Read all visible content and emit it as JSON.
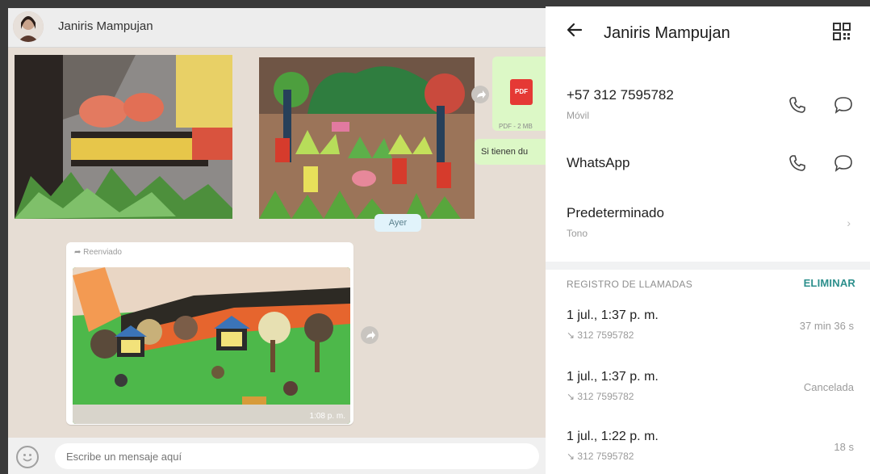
{
  "chat": {
    "contact_name": "Janiris Mampujan",
    "pdf_label": "PDF",
    "pdf_meta": "PDF - 2 MB",
    "text_preview": "Si tienen du",
    "chip": "Ayer",
    "forwarded_label": "Reenviado",
    "photo_time": "1:08 p. m.",
    "composer_placeholder": "Escribe un mensaje aquí",
    "icons": {
      "avatar": "avatar",
      "share": "share-icon",
      "emoji": "emoji-icon"
    }
  },
  "contact": {
    "title": "Janiris Mampujan",
    "phone_row": {
      "number": "+57 312 7595782",
      "label": "Móvil"
    },
    "whatsapp_row": {
      "label": "WhatsApp"
    },
    "default_row": {
      "label": "Predeterminado",
      "sub": "Tono",
      "chevron": "›"
    },
    "call_log": {
      "header": "REGISTRO DE LLAMADAS",
      "delete_label": "ELIMINAR",
      "entries": [
        {
          "time": "1 jul., 1:37 p. m.",
          "number": "312 7595782",
          "status": "37 min 36 s"
        },
        {
          "time": "1 jul., 1:37 p. m.",
          "number": "312 7595782",
          "status": "Cancelada"
        },
        {
          "time": "1 jul., 1:22 p. m.",
          "number": "312 7595782",
          "status": "18 s"
        }
      ]
    },
    "icons": {
      "back": "back-arrow-icon",
      "qr": "qr-code-icon",
      "call": "phone-icon",
      "message": "message-icon"
    }
  },
  "colors": {
    "chat_bg": "#e6ddd4",
    "accent": "#2c8f8c",
    "outgoing_bubble": "#dcf8c6"
  }
}
